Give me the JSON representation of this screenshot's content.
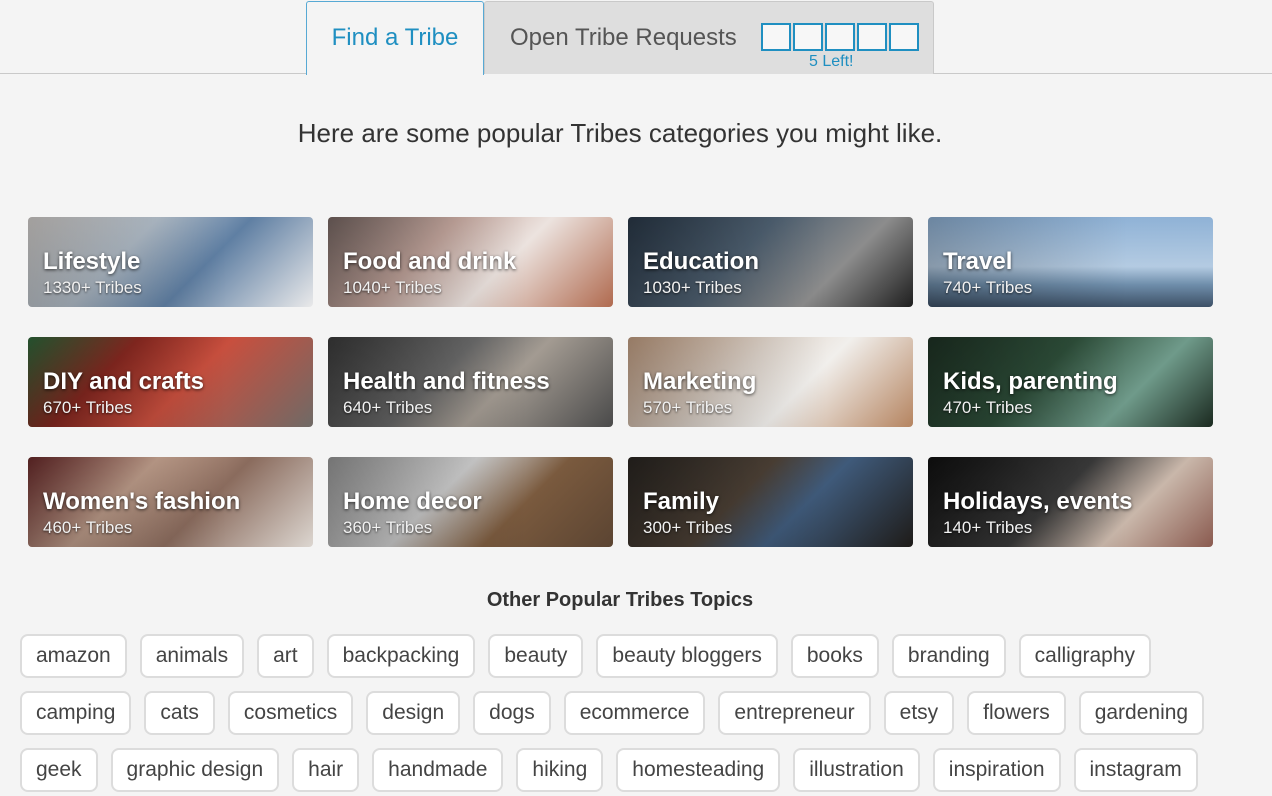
{
  "tabs": {
    "find": "Find a Tribe",
    "open": "Open Tribe Requests",
    "slots_total": 5,
    "slots_left": "5 Left!"
  },
  "intro": "Here are some popular Tribes categories you might like.",
  "categories": [
    {
      "name": "Lifestyle",
      "count": "1330+ Tribes",
      "bg": "linear-gradient(135deg,#d9d5d2 0%,#b7c3cf 35%,#5f7fa3 60%,#e9e9ea 100%)"
    },
    {
      "name": "Food and drink",
      "count": "1040+ Tribes",
      "bg": "linear-gradient(135deg,#7b6a66 0%,#c7a9a0 35%,#ece3df 60%,#b06a4f 100%)"
    },
    {
      "name": "Education",
      "count": "1030+ Tribes",
      "bg": "linear-gradient(135deg,#2b3a4a 0%,#4f6172 40%,#8c8c8c 70%,#1f1f1f 100%)"
    },
    {
      "name": "Travel",
      "count": "740+ Tribes",
      "bg": "linear-gradient(180deg,#8fb2d6 0%,#b4cbe2 55%,#6f8eab 75%,#3d5066 100%)"
    },
    {
      "name": "DIY and crafts",
      "count": "670+ Tribes",
      "bg": "linear-gradient(135deg,#2f6b3c 0%,#8e2a22 30%,#c84f3e 55%,#6f6a66 100%)"
    },
    {
      "name": "Health and fitness",
      "count": "640+ Tribes",
      "bg": "linear-gradient(135deg,#3c3c3c 0%,#6a6a6a 40%,#a39b92 60%,#4a4a4a 100%)"
    },
    {
      "name": "Marketing",
      "count": "570+ Tribes",
      "bg": "linear-gradient(135deg,#c8a386 0%,#e2d8cf 40%,#f1efec 60%,#b58460 100%)"
    },
    {
      "name": "Kids, parenting",
      "count": "470+ Tribes",
      "bg": "linear-gradient(135deg,#1f3325 0%,#2e4f3a 40%,#6f9a8a 70%,#1b2a20 100%)"
    },
    {
      "name": "Women's fashion",
      "count": "460+ Tribes",
      "bg": "linear-gradient(135deg,#6d2b2b 0%,#c4a28f 35%,#8a6b5d 60%,#dcd6d0 100%)"
    },
    {
      "name": "Home decor",
      "count": "360+ Tribes",
      "bg": "linear-gradient(135deg,#9b9b9b 0%,#cfcfcf 40%,#7a5a3e 65%,#5b4432 100%)"
    },
    {
      "name": "Family",
      "count": "300+ Tribes",
      "bg": "linear-gradient(135deg,#2a2622 0%,#4d4136 40%,#3f5a7a 60%,#1e1b18 100%)"
    },
    {
      "name": "Holidays, events",
      "count": "140+ Tribes",
      "bg": "linear-gradient(135deg,#111111 0%,#3a3a3a 45%,#c9b7aa 70%,#8a5a4f 100%)"
    }
  ],
  "topics_title": "Other Popular Tribes Topics",
  "topic_rows": [
    [
      "amazon",
      "animals",
      "art",
      "backpacking",
      "beauty",
      "beauty bloggers",
      "books",
      "branding",
      "calligraphy"
    ],
    [
      "camping",
      "cats",
      "cosmetics",
      "design",
      "dogs",
      "ecommerce",
      "entrepreneur",
      "etsy",
      "flowers",
      "gardening"
    ],
    [
      "geek",
      "graphic design",
      "hair",
      "handmade",
      "hiking",
      "homesteading",
      "illustration",
      "inspiration",
      "instagram"
    ]
  ]
}
